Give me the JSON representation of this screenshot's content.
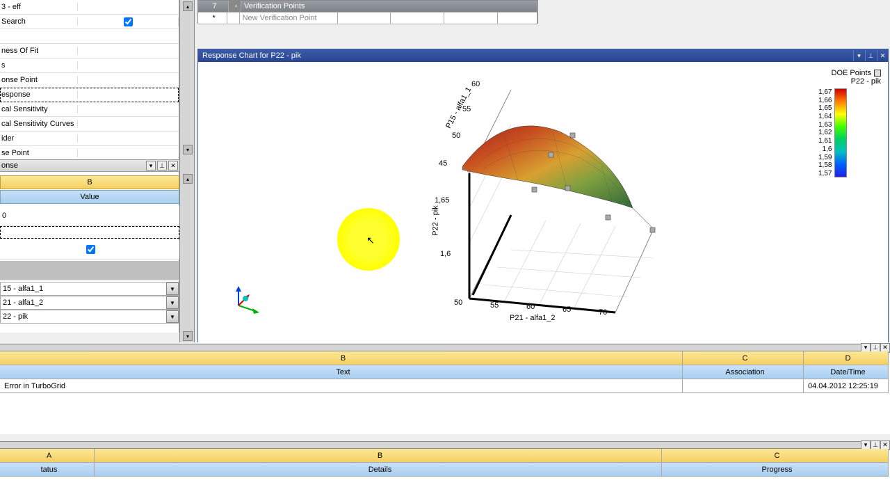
{
  "tree": {
    "items": [
      {
        "label": "3 - eff",
        "checked": false
      },
      {
        "label": " Search",
        "checked": true
      },
      {
        "label": "",
        "checked": false
      },
      {
        "label": "ness Of Fit",
        "checked": false
      },
      {
        "label": "s",
        "checked": false
      },
      {
        "label": "onse Point",
        "checked": false
      },
      {
        "label": "esponse",
        "checked": false,
        "selected": true
      },
      {
        "label": "cal Sensitivity",
        "checked": false
      },
      {
        "label": "cal Sensitivity Curves",
        "checked": false
      },
      {
        "label": "ider",
        "checked": false
      },
      {
        "label": "se Point",
        "checked": false
      }
    ]
  },
  "props": {
    "header": "onse",
    "col_b": "B",
    "col_value": "Value",
    "row0": "0",
    "dropdowns": [
      "15 - alfa1_1",
      "21 - alfa1_2",
      "22 - pik"
    ]
  },
  "verification": {
    "row_num": "7",
    "title": "Verification Points",
    "star": "*",
    "new_label": "New Verification Point"
  },
  "chart": {
    "title": "Response Chart for P22 - pik",
    "legend_doe": "DOE Points",
    "legend_p22": "P22 - pik",
    "colorbar_values": [
      "1,67",
      "1,66",
      "1,65",
      "1,64",
      "1,63",
      "1,62",
      "1,61",
      "1,6",
      "1,59",
      "1,58",
      "1,57"
    ],
    "y_axis_label": "P15 - alfa1_1",
    "x_axis_label": "P21 - alfa1_2",
    "z_axis_label": "P22 - pik",
    "y_ticks": [
      "60",
      "55",
      "50",
      "45"
    ],
    "z_ticks": [
      "1,65",
      "1,6"
    ],
    "x_ticks": [
      "50",
      "55",
      "60",
      "65",
      "70"
    ]
  },
  "messages": {
    "col_b": "B",
    "col_c": "C",
    "col_d": "D",
    "header_text": "Text",
    "header_assoc": "Association",
    "header_date": "Date/Time",
    "row_text": "Error in TurboGrid",
    "row_assoc": "",
    "row_date": "04.04.2012 12:25:19"
  },
  "progress": {
    "col_a": "A",
    "col_b": "B",
    "col_c": "C",
    "header_status": "tatus",
    "header_details": "Details",
    "header_progress": "Progress"
  },
  "chart_data": {
    "type": "surface3d",
    "title": "Response Chart for P22 - pik",
    "x_axis": "P21 - alfa1_2",
    "y_axis": "P15 - alfa1_1",
    "z_axis": "P22 - pik",
    "x_range": [
      50,
      70
    ],
    "y_range": [
      45,
      60
    ],
    "z_range": [
      1.57,
      1.67
    ],
    "doe_points_visible": true,
    "colorbar": {
      "min": 1.57,
      "max": 1.67
    }
  }
}
